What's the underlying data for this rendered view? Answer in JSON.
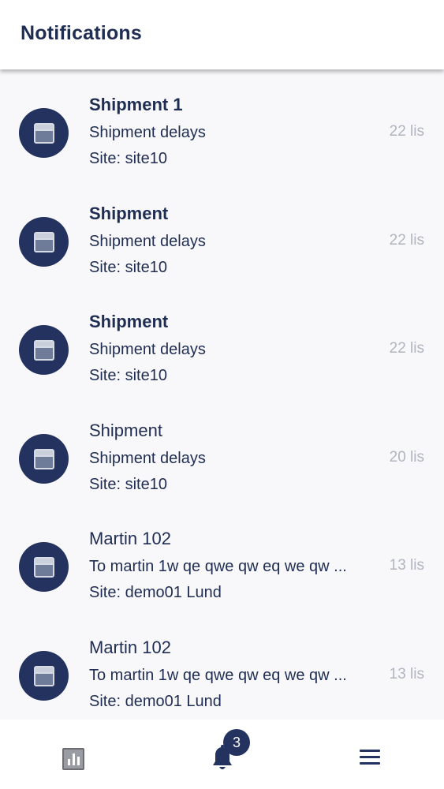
{
  "header": {
    "title": "Notifications"
  },
  "notifications": [
    {
      "title": "Shipment 1",
      "description": "Shipment delays",
      "site": "Site: site10",
      "time": "22 lis",
      "unread": true,
      "icon": "calendar-icon"
    },
    {
      "title": "Shipment",
      "description": "Shipment delays",
      "site": "Site: site10",
      "time": "22 lis",
      "unread": true,
      "icon": "calendar-icon"
    },
    {
      "title": "Shipment",
      "description": "Shipment delays",
      "site": "Site: site10",
      "time": "22 lis",
      "unread": true,
      "icon": "calendar-icon"
    },
    {
      "title": "Shipment",
      "description": "Shipment delays",
      "site": "Site: site10",
      "time": "20 lis",
      "unread": false,
      "icon": "calendar-icon"
    },
    {
      "title": "Martin 102",
      "description": "To martin 1w qe qwe qw eq we qw ...",
      "site": "Site: demo01 Lund",
      "time": "13 lis",
      "unread": false,
      "icon": "calendar-icon"
    },
    {
      "title": "Martin 102",
      "description": "To martin 1w qe qwe qw eq we qw ...",
      "site": "Site: demo01 Lund",
      "time": "13 lis",
      "unread": false,
      "icon": "calendar-icon"
    }
  ],
  "bottom_nav": {
    "items": [
      {
        "name": "stats",
        "icon": "bar-chart-icon"
      },
      {
        "name": "notifications",
        "icon": "bell-icon",
        "badge": "3"
      },
      {
        "name": "menu",
        "icon": "hamburger-menu-icon"
      }
    ]
  },
  "colors": {
    "primary": "#23325e",
    "text": "#1f2d52",
    "muted": "#b1b4bd",
    "background": "#f8f8fb"
  }
}
